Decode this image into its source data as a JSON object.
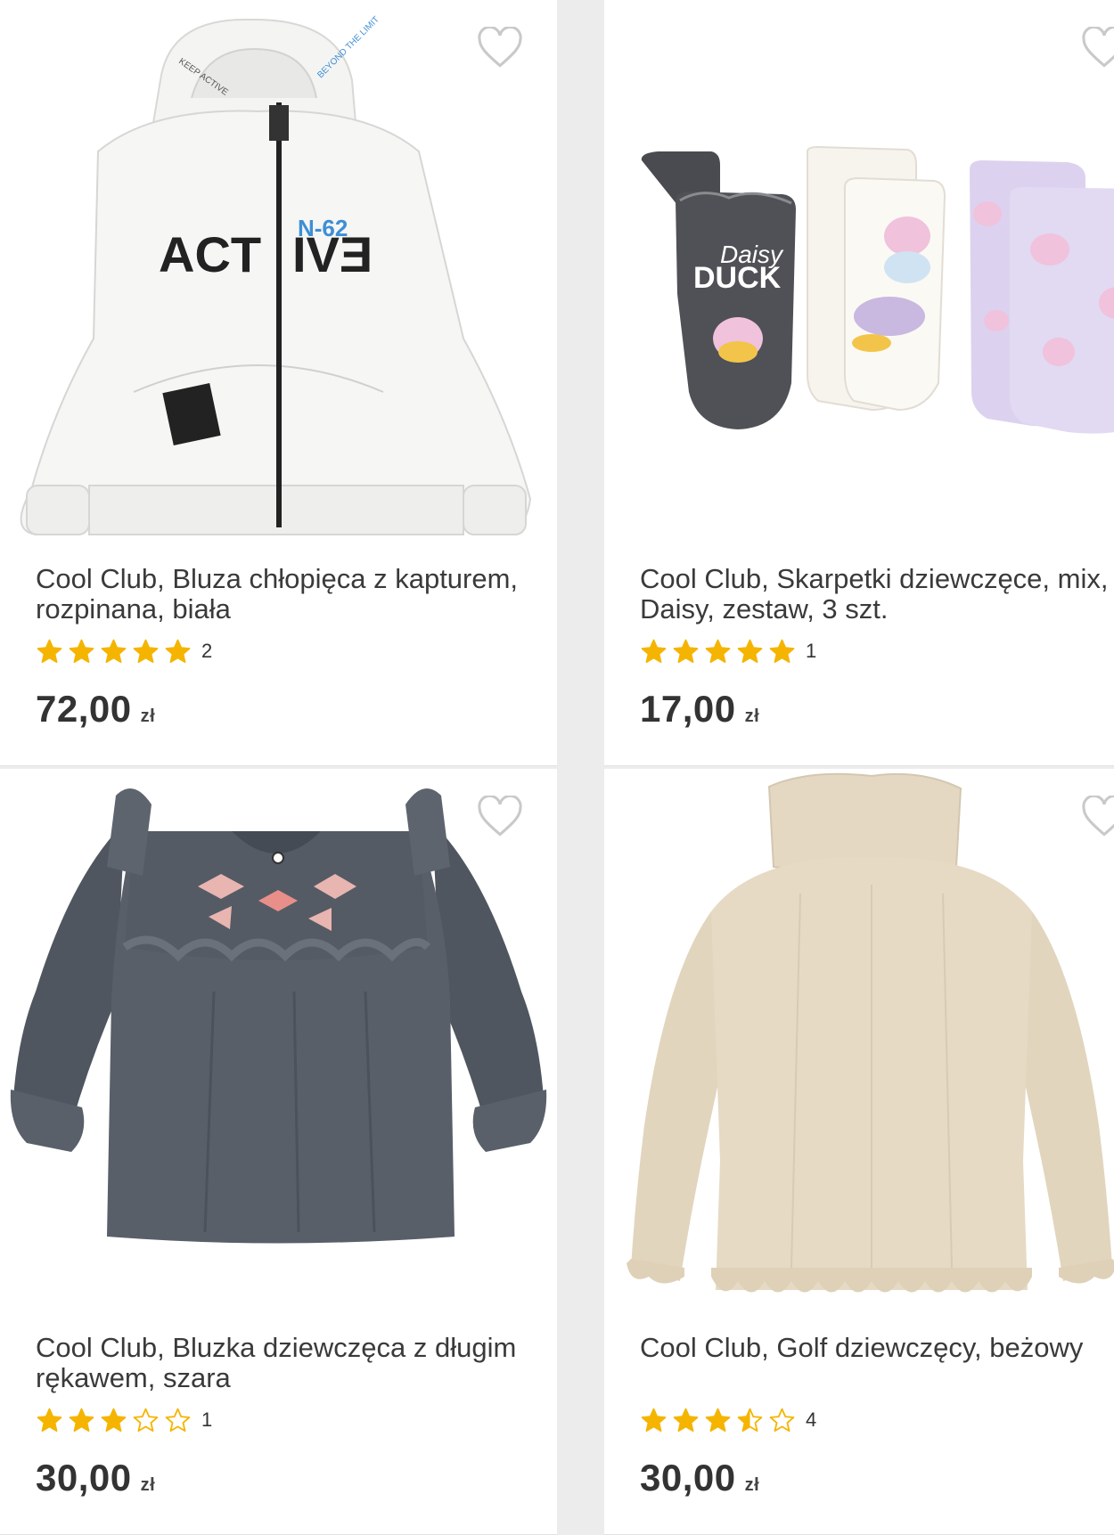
{
  "accent_star": "#f5b400",
  "products": [
    {
      "title": "Cool Club, Bluza chłopięca z kapturem, rozpinana, biała",
      "rating": 5,
      "review_count": "2",
      "price": "72,00",
      "currency": "zł",
      "image": {
        "icon": "white-zip-hoodie",
        "print_left": "ACT",
        "print_right": "IVƎ",
        "print_code": "N-62",
        "hood_text_left": "KEEP ACTIVE",
        "hood_text_right": "BEYOND THE LIMIT"
      }
    },
    {
      "title": "Cool Club, Skarpetki dziewczęce, mix, Daisy, zestaw, 3 szt.",
      "rating": 5,
      "review_count": "1",
      "price": "17,00",
      "currency": "zł",
      "image": {
        "icon": "socks-set",
        "sock_text_1": "Daisy",
        "sock_text_2": "DUCK"
      }
    },
    {
      "title": "Cool Club, Bluzka dziewczęca z długim rękawem, szara",
      "rating": 3,
      "review_count": "1",
      "price": "30,00",
      "currency": "zł",
      "image": {
        "icon": "grey-ruffle-blouse"
      }
    },
    {
      "title": "Cool Club, Golf dziewczęcy, beżowy",
      "rating": 3.5,
      "review_count": "4",
      "price": "30,00",
      "currency": "zł",
      "image": {
        "icon": "beige-turtleneck"
      }
    }
  ]
}
